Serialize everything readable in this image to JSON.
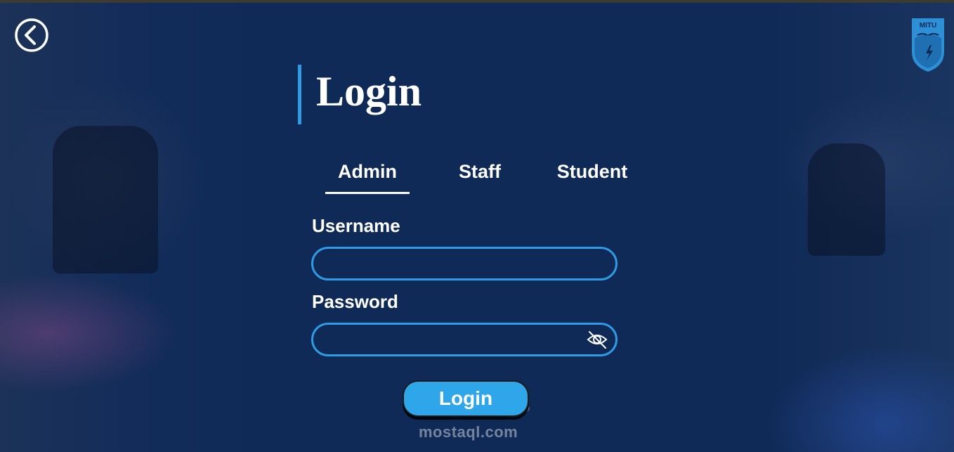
{
  "page": {
    "title": "Login"
  },
  "tabs": [
    {
      "label": "Admin",
      "active": true
    },
    {
      "label": "Staff",
      "active": false
    },
    {
      "label": "Student",
      "active": false
    }
  ],
  "form": {
    "username_label": "Username",
    "username_value": "",
    "password_label": "Password",
    "password_value": "",
    "submit_label": "Login"
  },
  "logo": {
    "text": "MITU"
  },
  "icons": {
    "back": "chevron-left-circle-icon",
    "password_toggle": "eye-slash-icon"
  },
  "watermark": {
    "text": "mostaql.com"
  },
  "colors": {
    "background": "#0f2a57",
    "accent": "#2f9be4",
    "button": "#2fa6ea",
    "text": "#ffffff"
  }
}
